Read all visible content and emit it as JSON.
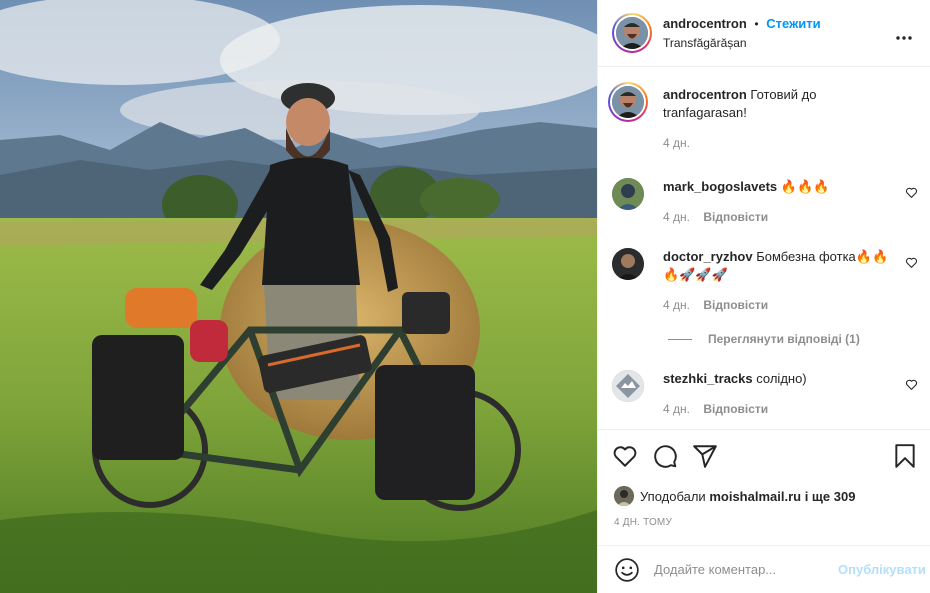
{
  "post": {
    "author": "androcentron",
    "follow_label": "Стежити",
    "separator": "•",
    "location": "Transfăgărășan",
    "caption_author": "androcentron",
    "caption_text": "Готовий до tranfagarasan!",
    "caption_time": "4 дн."
  },
  "comments": [
    {
      "username": "mark_bogoslavets",
      "text": "🔥🔥🔥",
      "time": "4 дн.",
      "reply_label": "Відповісти"
    },
    {
      "username": "doctor_ryzhov",
      "text": "Бомбезна фотка🔥🔥🔥🚀🚀🚀",
      "time": "4 дн.",
      "reply_label": "Відповісти"
    },
    {
      "username": "stezhki_tracks",
      "text": "солідно)",
      "time": "4 дн.",
      "reply_label": "Відповісти"
    }
  ],
  "view_replies_label": "Переглянути відповіді (1)",
  "likes": {
    "prefix": "Уподобали",
    "user": "moishalmail.ru",
    "suffix": "і ще 309"
  },
  "post_date": "4 ДН. ТОМУ",
  "composer": {
    "placeholder": "Додайте коментар...",
    "publish_label": "Опублікувати"
  },
  "colors": {
    "accent": "#0095f6",
    "publish_disabled": "#b2dffc",
    "muted": "#8e8e8e",
    "text": "#262626"
  },
  "icons": [
    "more-options-icon",
    "heart-icon",
    "comment-icon",
    "share-icon",
    "bookmark-icon",
    "emoji-icon"
  ]
}
